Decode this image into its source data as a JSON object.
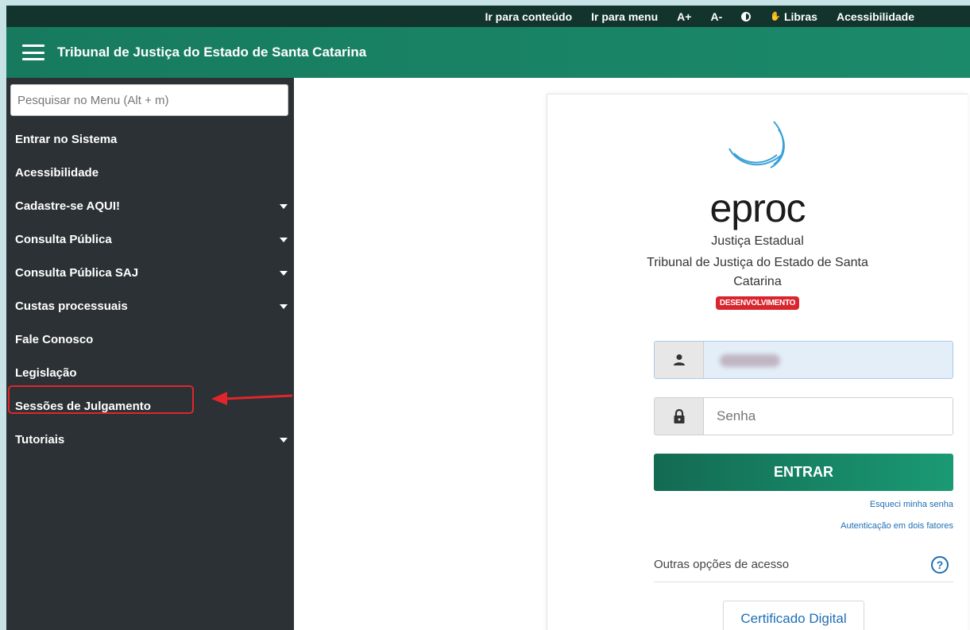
{
  "topbar": {
    "items": [
      "Ir para conteúdo",
      "Ir para menu",
      "A+",
      "A-"
    ],
    "libras": "Libras",
    "acessibilidade": "Acessibilidade"
  },
  "header": {
    "title": "Tribunal de Justiça do Estado de Santa Catarina"
  },
  "sidebar": {
    "search_placeholder": "Pesquisar no Menu (Alt + m)",
    "items": [
      {
        "label": "Entrar no Sistema",
        "has_submenu": false
      },
      {
        "label": "Acessibilidade",
        "has_submenu": false
      },
      {
        "label": "Cadastre-se AQUI!",
        "has_submenu": true
      },
      {
        "label": "Consulta Pública",
        "has_submenu": true
      },
      {
        "label": "Consulta Pública SAJ",
        "has_submenu": true
      },
      {
        "label": "Custas processuais",
        "has_submenu": true
      },
      {
        "label": "Fale Conosco",
        "has_submenu": false
      },
      {
        "label": "Legislação",
        "has_submenu": false
      },
      {
        "label": "Sessões de Julgamento",
        "has_submenu": false
      },
      {
        "label": "Tutoriais",
        "has_submenu": true
      }
    ]
  },
  "login": {
    "logo_text": "eproc",
    "justica": "Justiça Estadual",
    "tribunal": "Tribunal de Justiça do Estado de Santa Catarina",
    "env_badge": "DESENVOLVIMENTO",
    "password_placeholder": "Senha",
    "submit_label": "ENTRAR",
    "forgot_link": "Esqueci minha senha",
    "twofactor_link": "Autenticação em dois fatores",
    "other_options": "Outras opções de acesso",
    "help_symbol": "?",
    "certificate_button": "Certificado Digital"
  },
  "colors": {
    "topbar": "#12342c",
    "header": "#1b8a6a",
    "sidebar": "#2b3134",
    "highlight": "#e0262c",
    "link": "#1f6fb5"
  }
}
